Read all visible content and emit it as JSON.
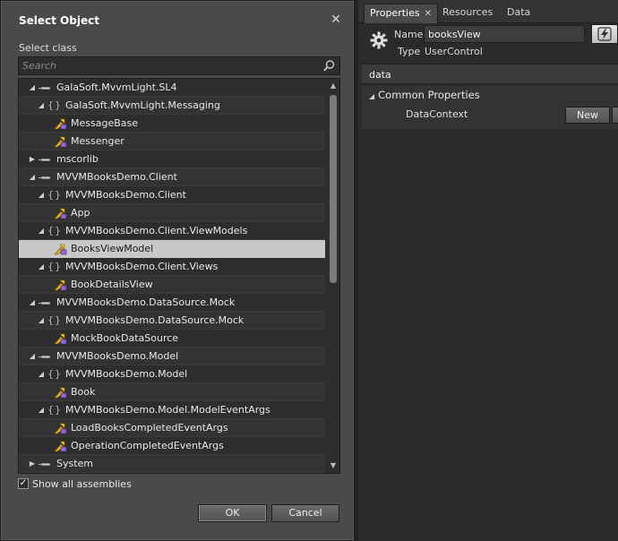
{
  "dialog": {
    "title": "Select Object",
    "close_glyph": "✕",
    "select_class_label": "Select class",
    "search_placeholder": "Search",
    "show_all_label": "Show all assemblies",
    "show_all_checked": true,
    "ok_label": "OK",
    "cancel_label": "Cancel"
  },
  "tree": {
    "rows": [
      {
        "level": 0,
        "kind": "assembly",
        "expanded": true,
        "label": "GalaSoft.MvvmLight.SL4"
      },
      {
        "level": 1,
        "kind": "namespace",
        "expanded": true,
        "label": "GalaSoft.MvvmLight.Messaging"
      },
      {
        "level": 2,
        "kind": "class",
        "label": "MessageBase"
      },
      {
        "level": 2,
        "kind": "class",
        "label": "Messenger"
      },
      {
        "level": 0,
        "kind": "assembly",
        "expanded": false,
        "label": "mscorlib"
      },
      {
        "level": 0,
        "kind": "assembly",
        "expanded": true,
        "label": "MVVMBooksDemo.Client"
      },
      {
        "level": 1,
        "kind": "namespace",
        "expanded": true,
        "label": "MVVMBooksDemo.Client"
      },
      {
        "level": 2,
        "kind": "class",
        "label": "App"
      },
      {
        "level": 1,
        "kind": "namespace",
        "expanded": true,
        "label": "MVVMBooksDemo.Client.ViewModels"
      },
      {
        "level": 2,
        "kind": "class",
        "label": "BooksViewModel",
        "selected": true
      },
      {
        "level": 1,
        "kind": "namespace",
        "expanded": true,
        "label": "MVVMBooksDemo.Client.Views"
      },
      {
        "level": 2,
        "kind": "class",
        "label": "BookDetailsView"
      },
      {
        "level": 0,
        "kind": "assembly",
        "expanded": true,
        "label": "MVVMBooksDemo.DataSource.Mock"
      },
      {
        "level": 1,
        "kind": "namespace",
        "expanded": true,
        "label": "MVVMBooksDemo.DataSource.Mock"
      },
      {
        "level": 2,
        "kind": "class",
        "label": "MockBookDataSource"
      },
      {
        "level": 0,
        "kind": "assembly",
        "expanded": true,
        "label": "MVVMBooksDemo.Model"
      },
      {
        "level": 1,
        "kind": "namespace",
        "expanded": true,
        "label": "MVVMBooksDemo.Model"
      },
      {
        "level": 2,
        "kind": "class",
        "label": "Book"
      },
      {
        "level": 1,
        "kind": "namespace",
        "expanded": true,
        "label": "MVVMBooksDemo.Model.ModelEventArgs"
      },
      {
        "level": 2,
        "kind": "class",
        "label": "LoadBooksCompletedEventArgs"
      },
      {
        "level": 2,
        "kind": "class",
        "label": "OperationCompletedEventArgs"
      },
      {
        "level": 0,
        "kind": "assembly",
        "expanded": false,
        "label": "System"
      }
    ]
  },
  "panel": {
    "tabs": [
      {
        "label": "Properties",
        "active": true,
        "closable": true
      },
      {
        "label": "Resources",
        "active": false
      },
      {
        "label": "Data",
        "active": false
      }
    ],
    "name_label": "Name",
    "name_value": "booksView",
    "type_label": "Type",
    "type_value": "UserControl",
    "filter_value": "data",
    "category_label": "Common Properties",
    "property_label": "DataContext",
    "new_button_label": "New"
  },
  "colors": {
    "selected_row": "#c8c8c8",
    "background": "#2b2b2b",
    "dialog": "#4a4a4a"
  }
}
